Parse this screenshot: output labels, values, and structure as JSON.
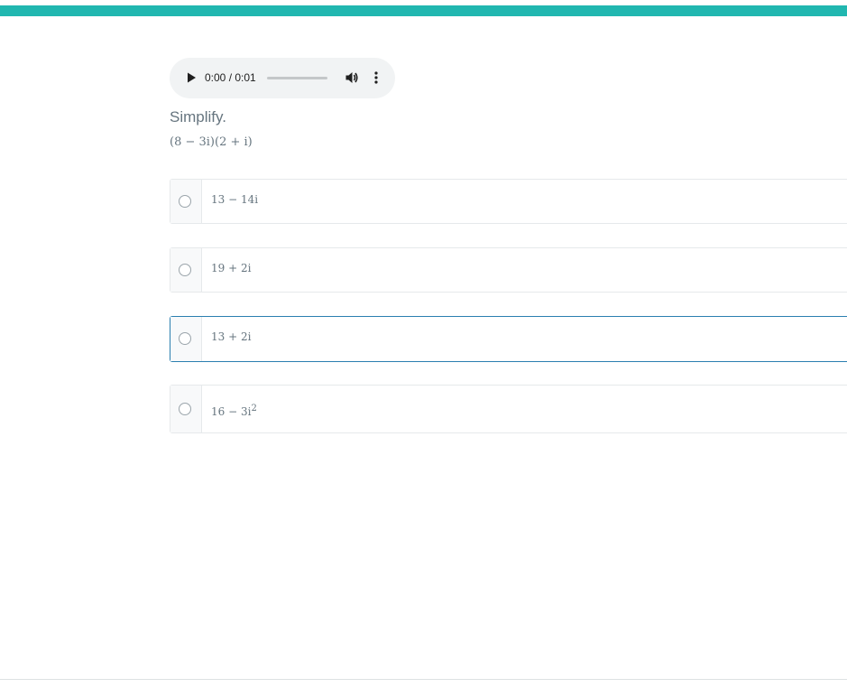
{
  "colors": {
    "accent": "#21b7b0",
    "highlight_border": "#2b7fb0",
    "text": "#66757f"
  },
  "audio": {
    "time": "0:00 / 0:01",
    "icons": [
      "play-icon",
      "volume-icon",
      "more-options-icon"
    ]
  },
  "question": {
    "prompt": "Simplify.",
    "expression": "(8 − 3i)(2 + i)"
  },
  "choices": [
    {
      "text": "13 − 14i"
    },
    {
      "text": "19 + 2i"
    },
    {
      "text": "13 + 2i"
    },
    {
      "text": "16 − 3i",
      "superscript": "2"
    }
  ]
}
